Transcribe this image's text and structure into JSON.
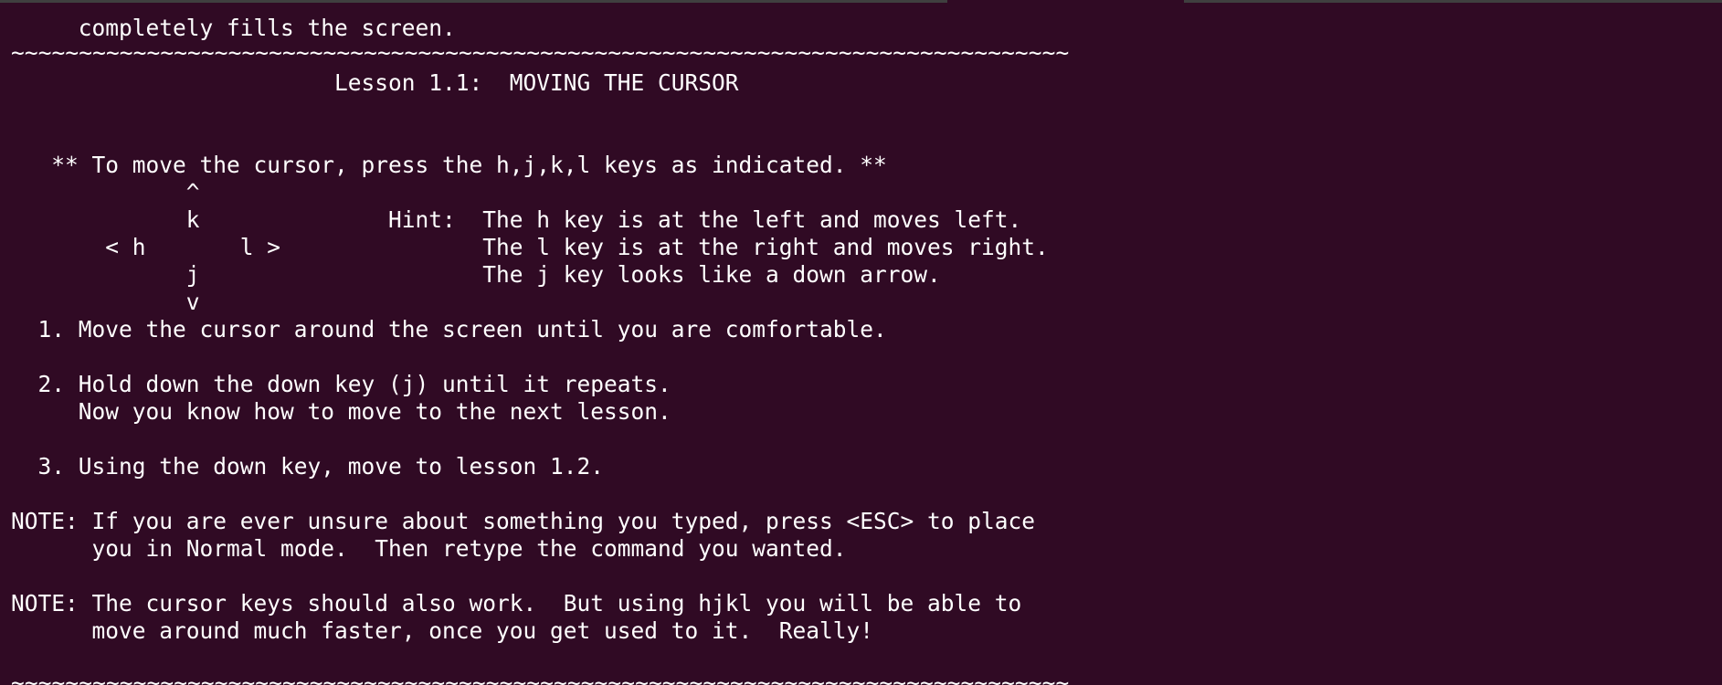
{
  "terminal": {
    "lines": [
      "     completely fills the screen.",
      "~~~~~~~~~~~~~~~~~~~~~~~~~~~~~~~~~~~~~~~~~~~~~~~~~~~~~~~~~~~~~~~~~~~~~~~~~~~~~~",
      "                        Lesson 1.1:  MOVING THE CURSOR",
      "",
      "",
      "   ** To move the cursor, press the h,j,k,l keys as indicated. **",
      "             ^",
      "             k              Hint:  The h key is at the left and moves left.",
      "       < h       l >               The l key is at the right and moves right.",
      "             j                     The j key looks like a down arrow.",
      "             v",
      "  1. Move the cursor around the screen until you are comfortable.",
      "",
      "  2. Hold down the down key (j) until it repeats.",
      "     Now you know how to move to the next lesson.",
      "",
      "  3. Using the down key, move to lesson 1.2.",
      "",
      "NOTE: If you are ever unsure about something you typed, press <ESC> to place",
      "      you in Normal mode.  Then retype the command you wanted.",
      "",
      "NOTE: The cursor keys should also work.  But using hjkl you will be able to",
      "      move around much faster, once you get used to it.  Really!",
      "",
      "~~~~~~~~~~~~~~~~~~~~~~~~~~~~~~~~~~~~~~~~~~~~~~~~~~~~~~~~~~~~~~~~~~~~~~~~~~~~~~"
    ]
  },
  "colors": {
    "background": "#300a24",
    "foreground": "#ffffff"
  }
}
